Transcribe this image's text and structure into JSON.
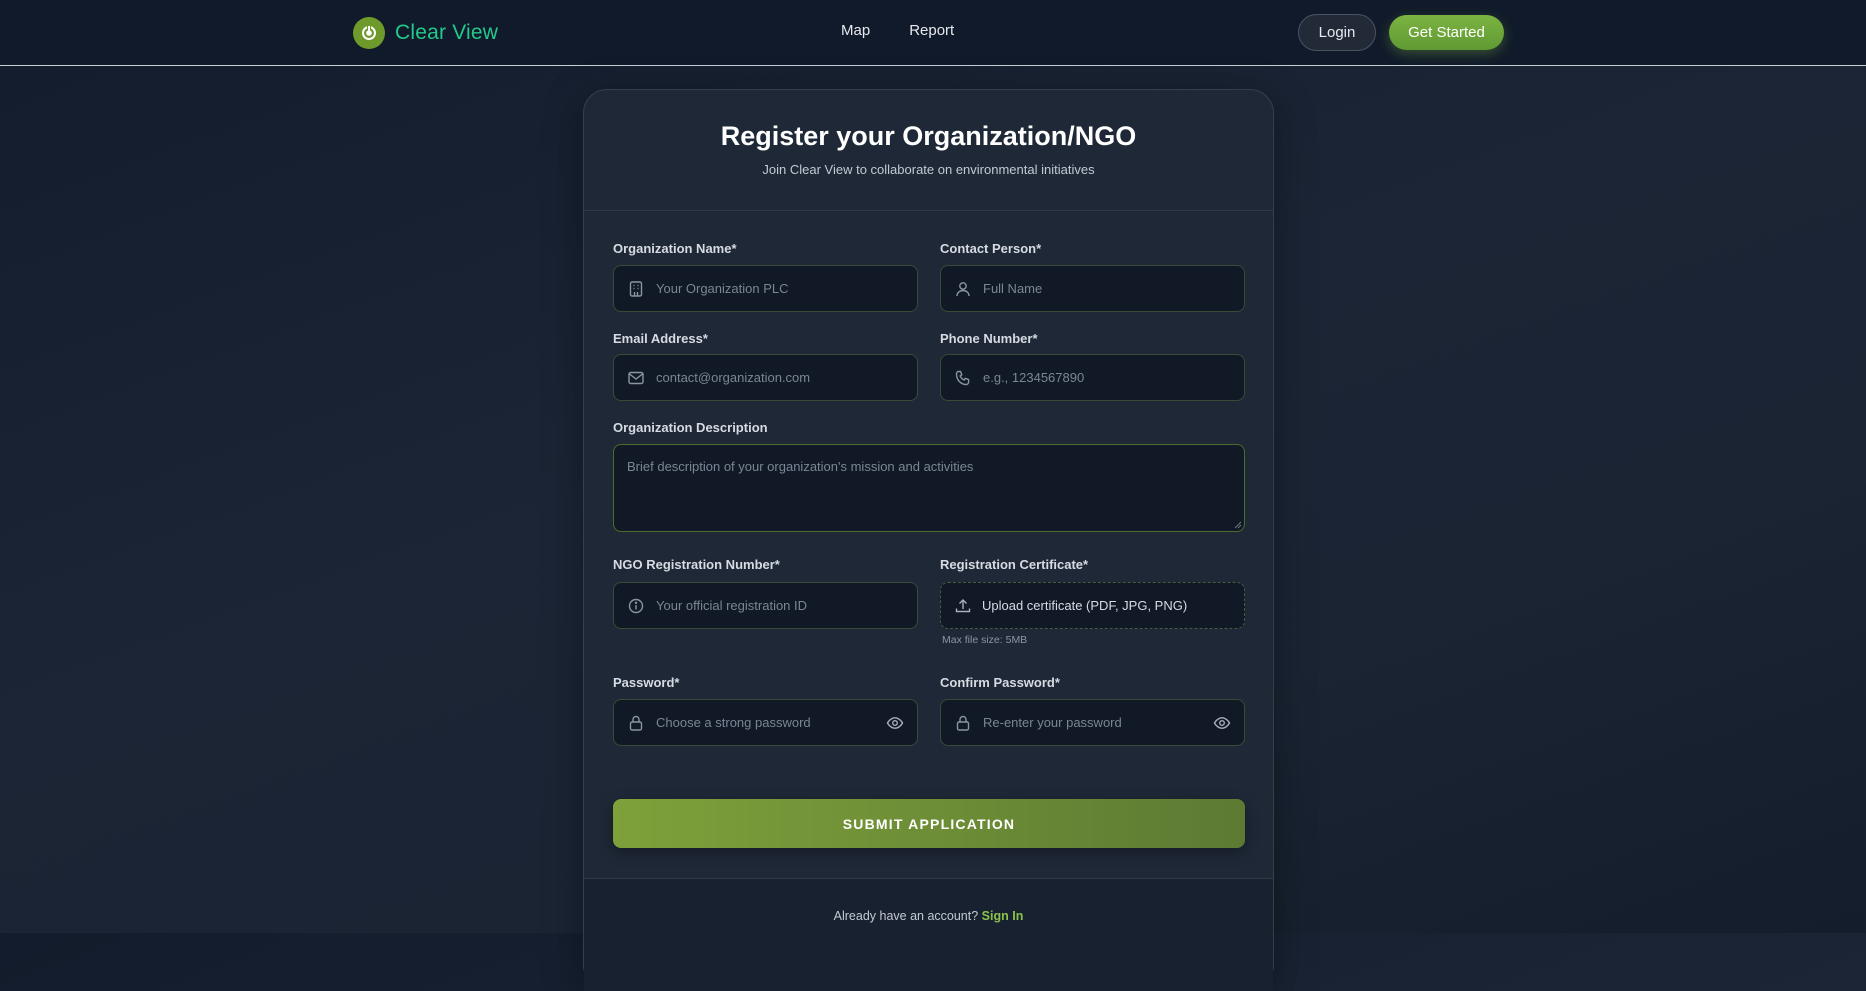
{
  "nav": {
    "brand": "Clear View",
    "links": [
      "Map",
      "Report"
    ],
    "login": "Login",
    "get_started": "Get Started"
  },
  "form": {
    "title": "Register your Organization/NGO",
    "subtitle": "Join Clear View to collaborate on environmental initiatives",
    "org_name": {
      "label": "Organization Name*",
      "placeholder": "Your Organization PLC",
      "icon": "building-icon"
    },
    "contact": {
      "label": "Contact Person*",
      "placeholder": "Full Name",
      "icon": "user-icon"
    },
    "email": {
      "label": "Email Address*",
      "placeholder": "contact@organization.com",
      "icon": "mail-icon"
    },
    "phone": {
      "label": "Phone Number*",
      "placeholder": "e.g., 1234567890",
      "icon": "phone-icon"
    },
    "description": {
      "label": "Organization Description",
      "placeholder": "Brief description of your organization's mission and activities"
    },
    "reg_number": {
      "label": "NGO Registration Number*",
      "placeholder": "Your official registration ID",
      "icon": "info-icon"
    },
    "certificate": {
      "label": "Registration Certificate*",
      "upload_text": "Upload certificate (PDF, JPG, PNG)",
      "hint": "Max file size: 5MB",
      "icon": "upload-icon"
    },
    "password": {
      "label": "Password*",
      "placeholder": "Choose a strong password",
      "icon": "lock-icon"
    },
    "confirm": {
      "label": "Confirm Password*",
      "placeholder": "Re-enter your password",
      "icon": "lock-icon"
    },
    "submit": "SUBMIT APPLICATION",
    "footer_text": "Already have an account?",
    "footer_link": "Sign In"
  },
  "colors": {
    "accent_green": "#7cb342",
    "brand_text": "#22c98a",
    "background": "#1a2433"
  }
}
